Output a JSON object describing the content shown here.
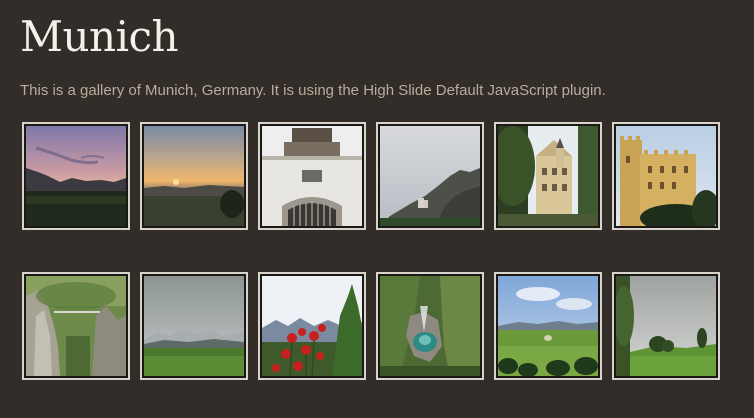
{
  "page": {
    "title": "Munich",
    "description": "This is a gallery of Munich, Germany. It is using the High Slide Default JavaScript plugin."
  },
  "colors": {
    "background": "#322d28",
    "title": "#f4f1ea",
    "text": "#b8ac9c",
    "thumb_border": "#d8d4cc"
  },
  "gallery": {
    "thumbnails": [
      {
        "id": "thumb-1",
        "subject": "twilight sky over dark hills"
      },
      {
        "id": "thumb-2",
        "subject": "sunset over a misty valley"
      },
      {
        "id": "thumb-3",
        "subject": "white gatehouse with iron gate"
      },
      {
        "id": "thumb-4",
        "subject": "castle on a rocky mountain under grey sky"
      },
      {
        "id": "thumb-5",
        "subject": "yellow castle behind trees"
      },
      {
        "id": "thumb-6",
        "subject": "ochre castle against blue sky"
      },
      {
        "id": "thumb-7",
        "subject": "rocky gorge with bridge"
      },
      {
        "id": "thumb-8",
        "subject": "green meadow and distant mountains"
      },
      {
        "id": "thumb-9",
        "subject": "red flowers in front of alps"
      },
      {
        "id": "thumb-10",
        "subject": "waterfall in green gorge"
      },
      {
        "id": "thumb-11",
        "subject": "wide green fields under blue sky"
      },
      {
        "id": "thumb-12",
        "subject": "meadow with trees under cloudy sky"
      }
    ]
  }
}
